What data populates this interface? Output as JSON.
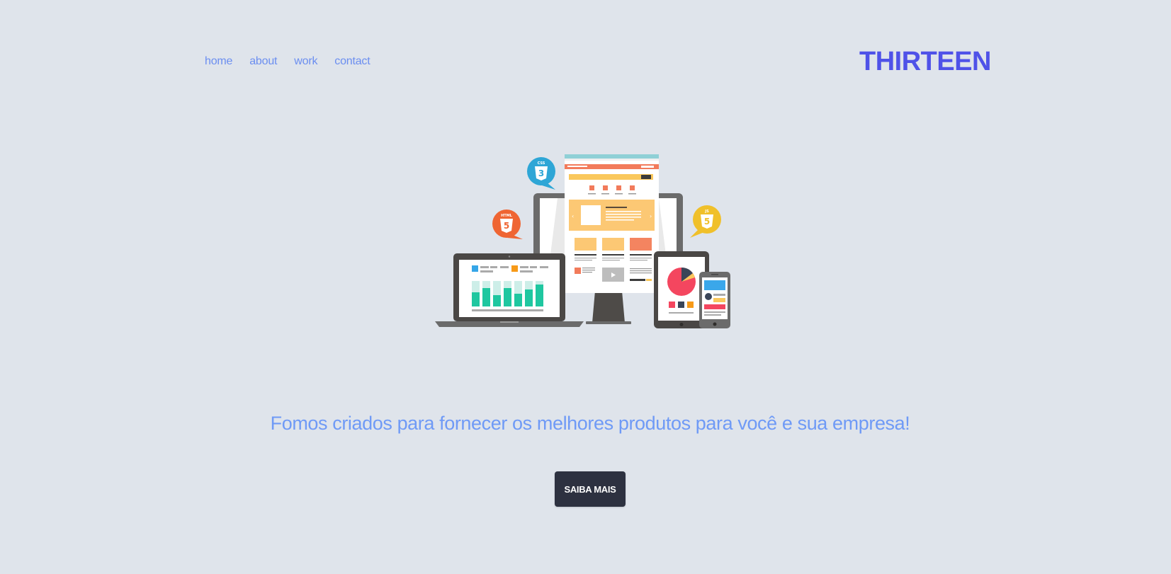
{
  "nav": {
    "items": [
      {
        "label": "home"
      },
      {
        "label": "about"
      },
      {
        "label": "work"
      },
      {
        "label": "contact"
      }
    ]
  },
  "brand": {
    "logo_text": "THIRTEEN"
  },
  "hero": {
    "tagline": "Fomos criados para fornecer os melhores produtos para você e sua empresa!",
    "cta_label": "SAIBA MAIS",
    "illustration_badges": {
      "css": "CSS",
      "html": "HTML",
      "js": "JS"
    }
  },
  "colors": {
    "background": "#dfe4eb",
    "nav_link": "#6b8ef0",
    "logo": "#4f52e8",
    "tagline": "#6f9af6",
    "button_bg": "#2d3140",
    "button_text": "#ffffff"
  }
}
